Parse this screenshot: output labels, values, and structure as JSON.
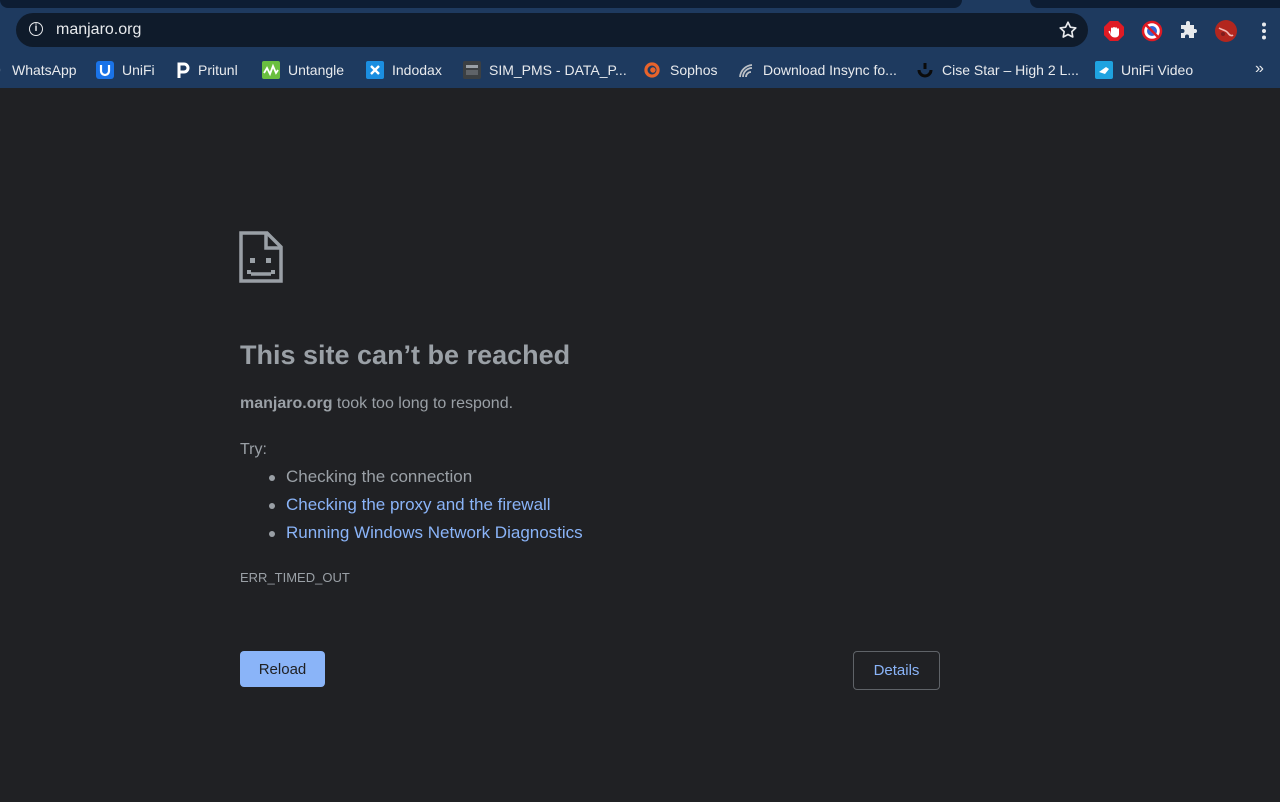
{
  "browser": {
    "url": "manjaro.org",
    "bookmarks": [
      {
        "label": "WhatsApp",
        "icon": "whatsapp-icon"
      },
      {
        "label": "UniFi",
        "icon": "unifi-icon"
      },
      {
        "label": "Pritunl",
        "icon": "pritunl-icon"
      },
      {
        "label": "Untangle",
        "icon": "untangle-icon"
      },
      {
        "label": "Indodax",
        "icon": "indodax-icon"
      },
      {
        "label": "SIM_PMS - DATA_P...",
        "icon": "sim-pms-icon"
      },
      {
        "label": "Sophos",
        "icon": "sophos-icon"
      },
      {
        "label": "Download Insync fo...",
        "icon": "insync-icon"
      },
      {
        "label": "Cise Star – High 2 L...",
        "icon": "cise-star-icon"
      },
      {
        "label": "UniFi Video",
        "icon": "unifi-video-icon"
      }
    ],
    "bookmarks_overflow": "»"
  },
  "error_page": {
    "title": "This site can’t be reached",
    "host": "manjaro.org",
    "description_suffix": " took too long to respond.",
    "try_label": "Try:",
    "suggestions": [
      {
        "label": "Checking the connection",
        "link": false
      },
      {
        "label": "Checking the proxy and the firewall",
        "link": true
      },
      {
        "label": "Running Windows Network Diagnostics",
        "link": true
      }
    ],
    "error_code": "ERR_TIMED_OUT",
    "reload_label": "Reload",
    "details_label": "Details"
  },
  "colors": {
    "page_background": "#202124",
    "toolbar_background": "#1e3a5f",
    "text_secondary": "#9aa0a6",
    "link": "#8ab4f8"
  }
}
